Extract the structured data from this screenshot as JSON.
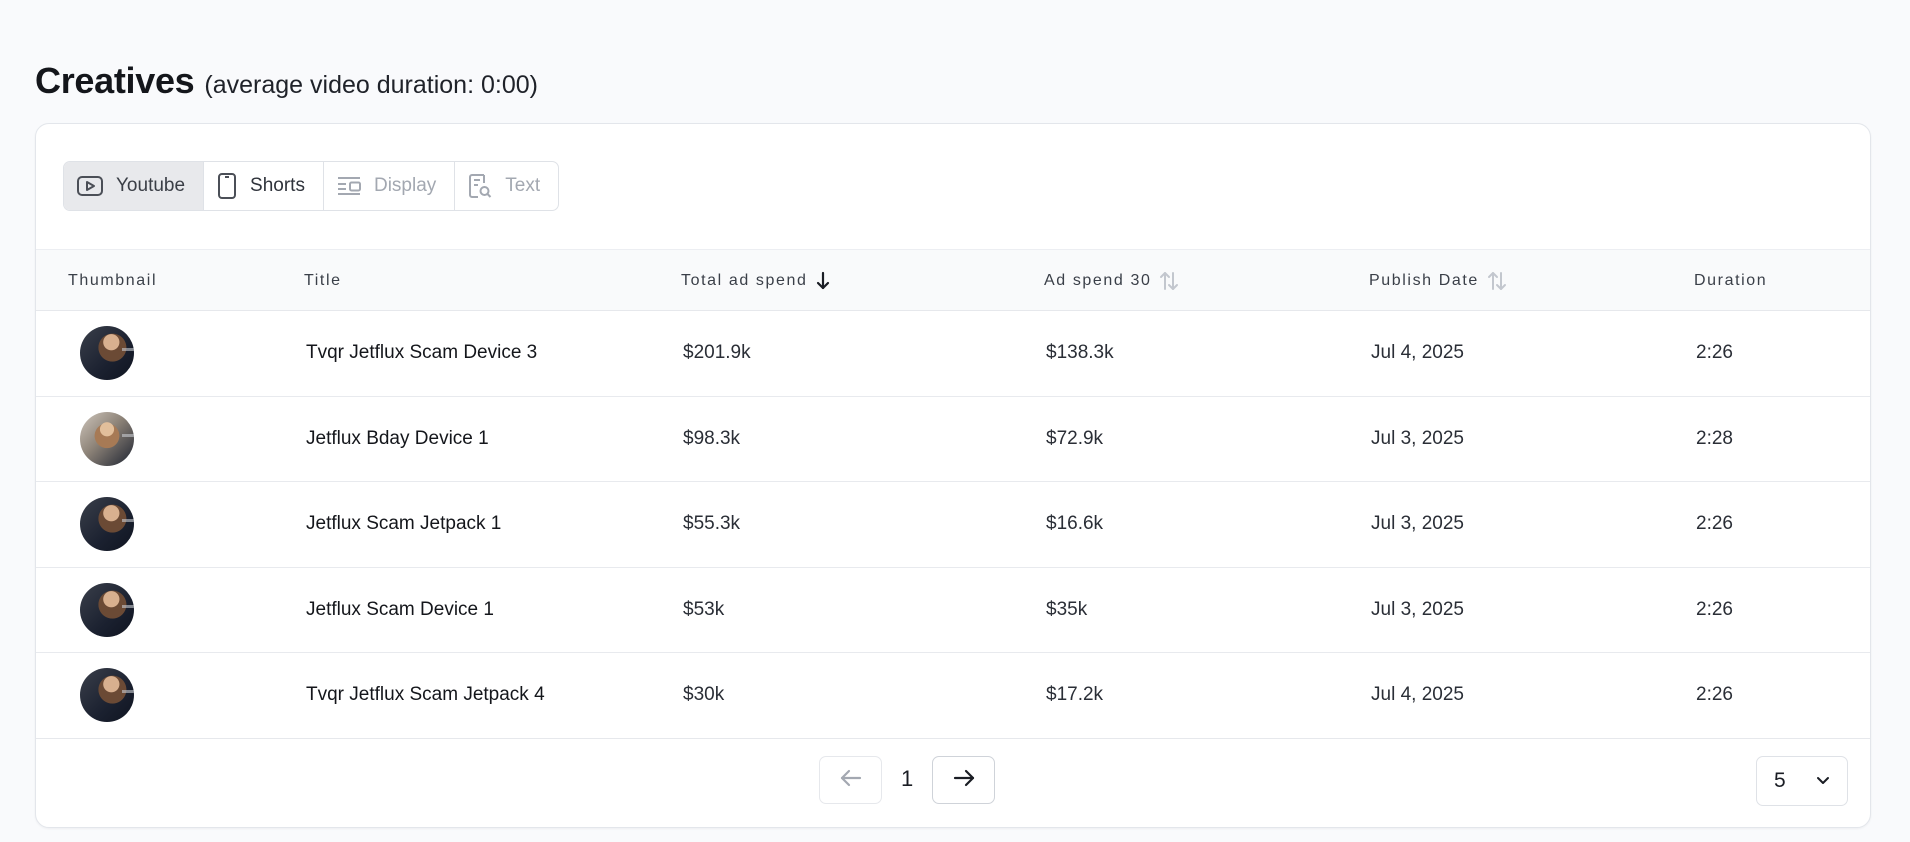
{
  "header": {
    "title": "Creatives",
    "subtitle": "(average video duration: 0:00)"
  },
  "tabs": [
    {
      "label": "Youtube",
      "icon": "youtube-icon",
      "state": "active"
    },
    {
      "label": "Shorts",
      "icon": "phone-icon",
      "state": "normal"
    },
    {
      "label": "Display",
      "icon": "display-layout-icon",
      "state": "disabled"
    },
    {
      "label": "Text",
      "icon": "text-search-icon",
      "state": "disabled"
    }
  ],
  "columns": {
    "thumbnail": "Thumbnail",
    "title": "Title",
    "total_ad_spend": "Total ad spend",
    "ad_spend_30": "Ad spend 30",
    "publish_date": "Publish Date",
    "duration": "Duration"
  },
  "sort": {
    "column": "total_ad_spend",
    "direction": "descending"
  },
  "rows": [
    {
      "title": "Tvqr Jetflux Scam Device 3",
      "total_ad_spend": "$201.9k",
      "ad_spend_30": "$138.3k",
      "publish_date": "Jul 4, 2025",
      "duration": "2:26"
    },
    {
      "title": "Jetflux Bday Device 1",
      "total_ad_spend": "$98.3k",
      "ad_spend_30": "$72.9k",
      "publish_date": "Jul 3, 2025",
      "duration": "2:28"
    },
    {
      "title": "Jetflux Scam Jetpack 1",
      "total_ad_spend": "$55.3k",
      "ad_spend_30": "$16.6k",
      "publish_date": "Jul 3, 2025",
      "duration": "2:26"
    },
    {
      "title": "Jetflux Scam Device 1",
      "total_ad_spend": "$53k",
      "ad_spend_30": "$35k",
      "publish_date": "Jul 3, 2025",
      "duration": "2:26"
    },
    {
      "title": "Tvqr Jetflux Scam Jetpack 4",
      "total_ad_spend": "$30k",
      "ad_spend_30": "$17.2k",
      "publish_date": "Jul 4, 2025",
      "duration": "2:26"
    }
  ],
  "pagination": {
    "current_page": "1",
    "page_size": "5"
  }
}
